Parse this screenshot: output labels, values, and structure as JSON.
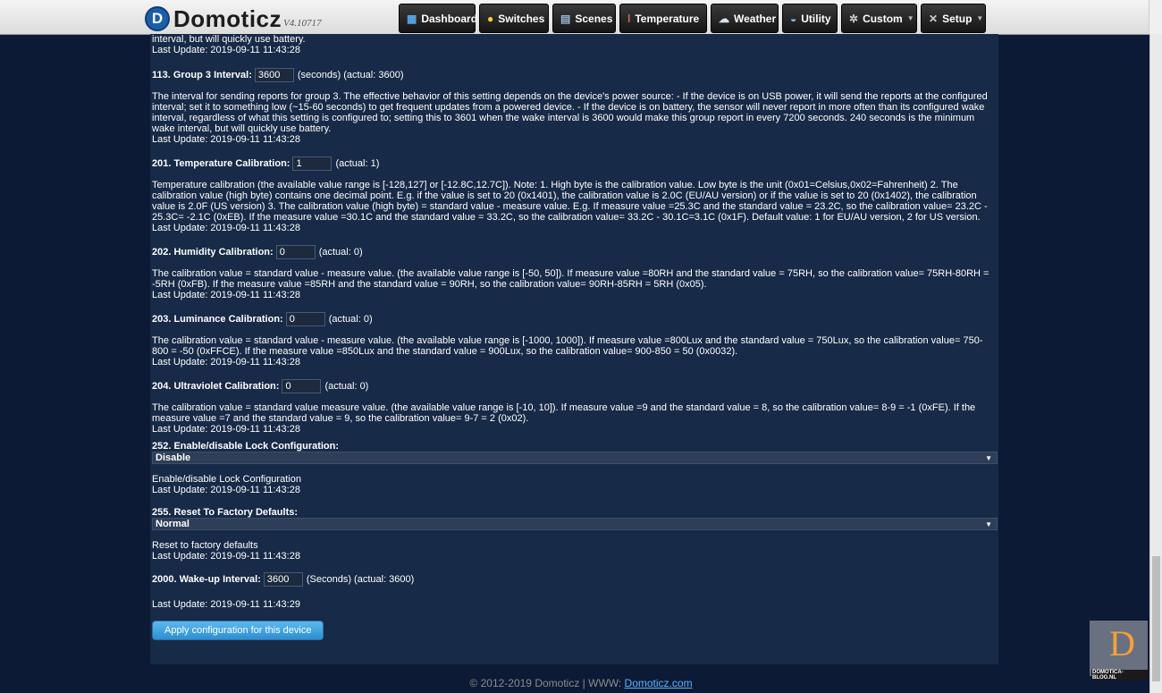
{
  "header": {
    "logo_letter": "D",
    "logo_text": "Domoticz",
    "version": "V4.10717",
    "nav": [
      {
        "label": "Dashboard",
        "icon": "dashboard-icon"
      },
      {
        "label": "Switches",
        "icon": "bulb-icon"
      },
      {
        "label": "Scenes",
        "icon": "scene-icon"
      },
      {
        "label": "Temperature",
        "icon": "thermometer-icon"
      },
      {
        "label": "Weather",
        "icon": "weather-icon"
      },
      {
        "label": "Utility",
        "icon": "utility-icon"
      },
      {
        "label": "Custom",
        "icon": "gear-icon"
      },
      {
        "label": "Setup",
        "icon": "tools-icon"
      }
    ]
  },
  "params": {
    "p112_tail": {
      "desc": "interval, but will quickly use battery.",
      "last": "Last Update: 2019-09-11 11:43:28"
    },
    "p113": {
      "label": "113. Group 3 Interval:",
      "value": "3600",
      "suffix": "(seconds) (actual: 3600)",
      "desc": "The interval for sending reports for group 3. The effective behavior of this setting depends on the device's power source: - If the device is on USB power, it will send the reports at the configured interval; set it to something low (~15-60 seconds) to get frequent updates from a powered device. - If the device is on battery, the sensor will never report in more often than its configured wake interval, regardless of what this setting is configured to; setting this to 3601 when the wake interval is 3600 would make this group report in every 7200 seconds. 240 seconds is the minimum wake interval, but will quickly use battery.",
      "last": "Last Update: 2019-09-11 11:43:28"
    },
    "p201": {
      "label": "201. Temperature Calibration:",
      "value": "1",
      "suffix": "(actual: 1)",
      "desc": "Temperature calibration (the available value range is [-128,127] or [-12.8C,12.7C]). Note: 1. High byte is the calibration value. Low byte is the unit (0x01=Celsius,0x02=Fahrenheit) 2. The calibration value (high byte) contains one decimal point. E.g. if the value is set to 20 (0x1401), the calibration value is 2.0C (EU/AU version) or if the value is set to 20 (0x1402), the calibration value is 2.0F (US version) 3. The calibration value (high byte) = standard value - measure value. E.g. If measure value =25.3C and the standard value = 23.2C, so the calibration value= 23.2C - 25.3C= -2.1C (0xEB). If the measure value =30.1C and the standard value = 33.2C, so the calibration value= 33.2C - 30.1C=3.1C (0x1F). Default value: 1 for EU/AU version, 2 for US version.",
      "last": "Last Update: 2019-09-11 11:43:28"
    },
    "p202": {
      "label": "202. Humidity Calibration:",
      "value": "0",
      "suffix": "(actual: 0)",
      "desc": "The calibration value = standard value - measure value. (the available value range is [-50, 50]). If measure value =80RH and the standard value = 75RH, so the calibration value= 75RH-80RH = -5RH (0xFB). If the measure value =85RH and the standard value = 90RH, so the calibration value= 90RH-85RH = 5RH (0x05).",
      "last": "Last Update: 2019-09-11 11:43:28"
    },
    "p203": {
      "label": "203. Luminance Calibration:",
      "value": "0",
      "suffix": "(actual: 0)",
      "desc": "The calibration value = standard value - measure value. (the available value range is [-1000, 1000]). If measure value =800Lux and the standard value = 750Lux, so the calibration value= 750-800 = -50 (0xFFCE). If the measure value =850Lux and the standard value = 900Lux, so the calibration value= 900-850 = 50 (0x0032).",
      "last": "Last Update: 2019-09-11 11:43:28"
    },
    "p204": {
      "label": "204. Ultraviolet Calibration:",
      "value": "0",
      "suffix": "(actual: 0)",
      "desc": "The calibration value = standard value measure value. (the available value range is [-10, 10]). If measure value =9 and the standard value = 8, so the calibration value= 8-9 = -1 (0xFE). If the measure value =7 and the standard value = 9, so the calibration value= 9-7 = 2 (0x02).",
      "last": "Last Update: 2019-09-11 11:43:28"
    },
    "p252": {
      "label": "252. Enable/disable Lock Configuration:",
      "value": "Disable",
      "desc": "Enable/disable Lock Configuration",
      "last": "Last Update: 2019-09-11 11:43:28"
    },
    "p255": {
      "label": "255. Reset To Factory Defaults:",
      "value": "Normal",
      "desc": "Reset to factory defaults",
      "last": "Last Update: 2019-09-11 11:43:28"
    },
    "p2000": {
      "label": "2000. Wake-up Interval:",
      "value": "3600",
      "suffix": "(Seconds) (actual: 3600)",
      "last": "Last Update: 2019-09-11 11:43:29"
    }
  },
  "apply_label": "Apply configuration for this device",
  "footer": {
    "text": "© 2012-2019 Domoticz | WWW: ",
    "link": "Domoticz.com"
  },
  "watermark": {
    "letter": "D",
    "text": "DOMOTICA-BLOG.NL"
  }
}
